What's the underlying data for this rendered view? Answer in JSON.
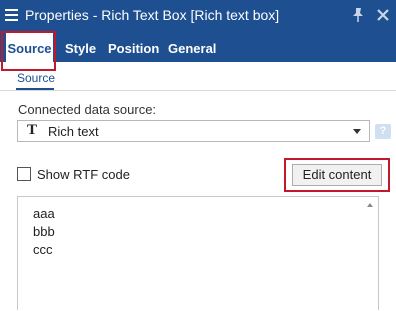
{
  "window": {
    "title": "Properties - Rich Text Box [Rich text box]",
    "menu_icon": "hamburger-menu-icon",
    "pin_icon": "pin-icon",
    "close_icon": "close-icon"
  },
  "tabs": [
    {
      "label": "Source",
      "active": true
    },
    {
      "label": "Style",
      "active": false
    },
    {
      "label": "Position",
      "active": false
    },
    {
      "label": "General",
      "active": false
    }
  ],
  "subtabs": [
    {
      "label": "Source",
      "active": true
    }
  ],
  "connected_data_source": {
    "label": "Connected data source:",
    "value": "Rich text",
    "type_icon_glyph": "T",
    "help_icon_glyph": "?"
  },
  "show_rtf": {
    "label": "Show RTF code",
    "checked": false
  },
  "edit_button": {
    "label": "Edit content"
  },
  "editor": {
    "lines": [
      "aaa",
      "bbb",
      "ccc"
    ]
  },
  "colors": {
    "accent": "#1d4f91",
    "callout": "#c0192b"
  }
}
